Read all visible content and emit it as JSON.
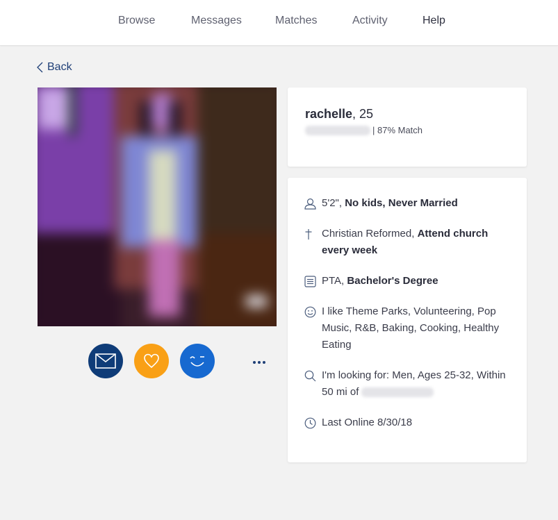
{
  "nav": {
    "items": [
      {
        "label": "Browse"
      },
      {
        "label": "Messages"
      },
      {
        "label": "Matches"
      },
      {
        "label": "Activity"
      },
      {
        "label": "Help"
      }
    ]
  },
  "back": {
    "label": "Back",
    "icon": "chevron-left-icon"
  },
  "photo": {
    "alt": "Profile photo (blurred)"
  },
  "actions": {
    "message": {
      "icon": "envelope-icon",
      "color": "#0f3c78"
    },
    "like": {
      "icon": "heart-icon",
      "color": "#f9a016"
    },
    "wink": {
      "icon": "wink-icon",
      "color": "#1769d0"
    },
    "more": {
      "icon": "more-dots-icon"
    }
  },
  "profile": {
    "name": "rachelle",
    "age": ", 25",
    "location_blurred": true,
    "match": "| 87% Match"
  },
  "details": [
    {
      "icon": "person-icon",
      "normal": "5'2\", ",
      "bold": "No kids, Never Married"
    },
    {
      "icon": "cross-icon",
      "normal": "Christian Reformed, ",
      "bold": "Attend church every week"
    },
    {
      "icon": "document-icon",
      "normal": "PTA, ",
      "bold": "Bachelor's Degree"
    },
    {
      "icon": "smiley-icon",
      "normal": "I like Theme Parks, Volunteering, Pop Music, R&B, Baking, Cooking, Healthy Eating",
      "bold": ""
    },
    {
      "icon": "search-icon",
      "normal": "I'm looking for: Men, Ages 25-32, Within 50 mi of",
      "bold": ""
    },
    {
      "icon": "clock-icon",
      "normal": "Last Online 8/30/18",
      "bold": ""
    }
  ],
  "colors": {
    "accent_navy": "#1f3f77",
    "background": "#f2f2f2"
  }
}
